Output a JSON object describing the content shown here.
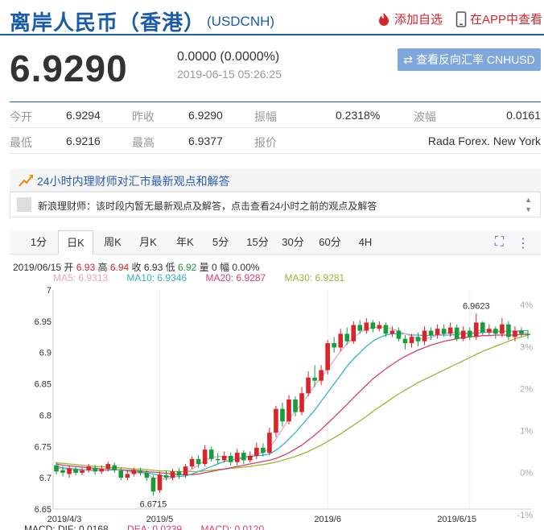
{
  "header": {
    "title": "离岸人民币（香港）",
    "symbol": "(USDCNH)",
    "watchlist_label": "添加自选",
    "app_label": "在APP中查看"
  },
  "quote": {
    "price": "6.9290",
    "change": "0.0000 (0.0000%)",
    "timestamp": "2019-06-15 05:26:25",
    "reverse_label": "查看反向汇率 CNHUSD"
  },
  "stats": [
    [
      {
        "label": "今开",
        "value": "6.9294"
      },
      {
        "label": "昨收",
        "value": "6.9290"
      },
      {
        "label": "振幅",
        "value": "0.2318%"
      },
      {
        "label": "波幅",
        "value": "0.0161"
      }
    ],
    [
      {
        "label": "最低",
        "value": "6.9216"
      },
      {
        "label": "最高",
        "value": "6.9377"
      },
      {
        "label": "报价",
        "value": "Rada Forex. New York"
      }
    ]
  ],
  "opinion": {
    "title": "24小时内理财师对汇市最新观点和解答",
    "text": "新浪理财师：该时段内暂无最新观点及解答，点击查看24小时之前的观点及解答"
  },
  "tabs": [
    "1分",
    "日K",
    "周K",
    "月K",
    "年K",
    "5分",
    "15分",
    "30分",
    "60分",
    "4H"
  ],
  "active_tab": "日K",
  "ohlc": {
    "date": "2019/06/15",
    "open_label": "开",
    "open": "6.93",
    "high_label": "高",
    "high": "6.94",
    "close_label": "收",
    "close": "6.93",
    "low_label": "低",
    "low": "6.92",
    "vol_label": "量",
    "vol": "0",
    "amp_label": "幅",
    "amp": "0.00%"
  },
  "ma": [
    {
      "label": "MA5: 6.9313",
      "color": "#e9a6c9"
    },
    {
      "label": "MA10: 6.9346",
      "color": "#36b3c9"
    },
    {
      "label": "MA20: 6.9287",
      "color": "#d6406e"
    },
    {
      "label": "MA30: 6.9281",
      "color": "#9ab838"
    }
  ],
  "macd": {
    "dif": "MACD: DIF: 0.0168",
    "dea": "DEA: 0.0239",
    "macd": "MACD: 0.0120"
  },
  "chart_data": {
    "type": "candlestick",
    "ylim": [
      6.65,
      7.0
    ],
    "y_ticks": [
      "7",
      "6.95",
      "6.9",
      "6.85",
      "6.8",
      "6.75",
      "6.7",
      "6.65"
    ],
    "pct_ticks": [
      "4%",
      "3%",
      "2%",
      "1%",
      "0%",
      "-1%"
    ],
    "x_labels": [
      "2019/4/3",
      "2019/5",
      "2019/6",
      "2019/6/15"
    ],
    "annotations": [
      {
        "label": "6.9623",
        "value": 6.9623
      },
      {
        "label": "6.6715",
        "value": 6.6715
      }
    ],
    "up_color": "#d6262b",
    "down_color": "#1a9c3a",
    "candles": [
      [
        6.72,
        6.71,
        6.725,
        6.705
      ],
      [
        6.712,
        6.708,
        6.718,
        6.702
      ],
      [
        6.706,
        6.715,
        6.72,
        6.7
      ],
      [
        6.714,
        6.708,
        6.718,
        6.704
      ],
      [
        6.708,
        6.712,
        6.716,
        6.704
      ],
      [
        6.712,
        6.718,
        6.722,
        6.708
      ],
      [
        6.716,
        6.71,
        6.72,
        6.705
      ],
      [
        6.71,
        6.714,
        6.72,
        6.706
      ],
      [
        6.714,
        6.722,
        6.726,
        6.71
      ],
      [
        6.72,
        6.712,
        6.724,
        6.708
      ],
      [
        6.712,
        6.7,
        6.716,
        6.696
      ],
      [
        6.7,
        6.706,
        6.712,
        6.696
      ],
      [
        6.706,
        6.712,
        6.716,
        6.702
      ],
      [
        6.712,
        6.708,
        6.716,
        6.704
      ],
      [
        6.708,
        6.7,
        6.712,
        6.695
      ],
      [
        6.7,
        6.678,
        6.704,
        6.6715
      ],
      [
        6.68,
        6.705,
        6.71,
        6.676
      ],
      [
        6.704,
        6.7,
        6.712,
        6.696
      ],
      [
        6.7,
        6.71,
        6.714,
        6.696
      ],
      [
        6.71,
        6.704,
        6.716,
        6.698
      ],
      [
        6.704,
        6.718,
        6.722,
        6.7
      ],
      [
        6.718,
        6.73,
        6.734,
        6.714
      ],
      [
        6.73,
        6.722,
        6.736,
        6.716
      ],
      [
        6.722,
        6.745,
        6.752,
        6.718
      ],
      [
        6.745,
        6.73,
        6.75,
        6.726
      ],
      [
        6.73,
        6.728,
        6.74,
        6.722
      ],
      [
        6.728,
        6.735,
        6.742,
        6.724
      ],
      [
        6.735,
        6.725,
        6.74,
        6.72
      ],
      [
        6.725,
        6.74,
        6.746,
        6.72
      ],
      [
        6.74,
        6.728,
        6.744,
        6.722
      ],
      [
        6.728,
        6.735,
        6.742,
        6.724
      ],
      [
        6.735,
        6.748,
        6.756,
        6.73
      ],
      [
        6.748,
        6.74,
        6.755,
        6.734
      ],
      [
        6.74,
        6.772,
        6.78,
        6.736
      ],
      [
        6.772,
        6.81,
        6.815,
        6.765
      ],
      [
        6.81,
        6.79,
        6.82,
        6.782
      ],
      [
        6.79,
        6.825,
        6.832,
        6.785
      ],
      [
        6.825,
        6.805,
        6.83,
        6.798
      ],
      [
        6.805,
        6.835,
        6.845,
        6.8
      ],
      [
        6.835,
        6.86,
        6.87,
        6.83
      ],
      [
        6.86,
        6.855,
        6.88,
        6.845
      ],
      [
        6.855,
        6.872,
        6.88,
        6.848
      ],
      [
        6.872,
        6.915,
        6.92,
        6.865
      ],
      [
        6.915,
        6.908,
        6.925,
        6.9
      ],
      [
        6.908,
        6.93,
        6.938,
        6.902
      ],
      [
        6.93,
        6.918,
        6.94,
        6.912
      ],
      [
        6.918,
        6.944,
        6.95,
        6.914
      ],
      [
        6.944,
        6.935,
        6.952,
        6.93
      ],
      [
        6.935,
        6.948,
        6.955,
        6.93
      ],
      [
        6.948,
        6.938,
        6.952,
        6.932
      ],
      [
        6.938,
        6.944,
        6.95,
        6.934
      ],
      [
        6.944,
        6.93,
        6.948,
        6.925
      ],
      [
        6.93,
        6.935,
        6.942,
        6.925
      ],
      [
        6.935,
        6.922,
        6.94,
        6.918
      ],
      [
        6.922,
        6.915,
        6.928,
        6.905
      ],
      [
        6.915,
        6.925,
        6.93,
        6.908
      ],
      [
        6.925,
        6.918,
        6.932,
        6.91
      ],
      [
        6.918,
        6.935,
        6.942,
        6.912
      ],
      [
        6.935,
        6.928,
        6.94,
        6.92
      ],
      [
        6.928,
        6.938,
        6.945,
        6.922
      ],
      [
        6.938,
        6.93,
        6.945,
        6.925
      ],
      [
        6.93,
        6.94,
        6.948,
        6.925
      ],
      [
        6.94,
        6.922,
        6.945,
        6.918
      ],
      [
        6.922,
        6.935,
        6.942,
        6.918
      ],
      [
        6.935,
        6.925,
        6.94,
        6.92
      ],
      [
        6.925,
        6.948,
        6.9623,
        6.92
      ],
      [
        6.948,
        6.932,
        6.95,
        6.928
      ],
      [
        6.932,
        6.938,
        6.945,
        6.928
      ],
      [
        6.938,
        6.93,
        6.942,
        6.922
      ],
      [
        6.93,
        6.945,
        6.955,
        6.925
      ],
      [
        6.945,
        6.925,
        6.95,
        6.92
      ],
      [
        6.925,
        6.935,
        6.942,
        6.918
      ],
      [
        6.935,
        6.93,
        6.94,
        6.925
      ],
      [
        6.93,
        6.928,
        6.936,
        6.922
      ]
    ],
    "ma5": [
      6.716,
      6.714,
      6.713,
      6.712,
      6.711,
      6.713,
      6.713,
      6.712,
      6.714,
      6.715,
      6.712,
      6.71,
      6.708,
      6.707,
      6.706,
      6.7,
      6.698,
      6.698,
      6.7,
      6.704,
      6.708,
      6.714,
      6.72,
      6.728,
      6.732,
      6.734,
      6.734,
      6.732,
      6.732,
      6.733,
      6.735,
      6.738,
      6.74,
      6.748,
      6.762,
      6.778,
      6.794,
      6.806,
      6.818,
      6.832,
      6.848,
      6.86,
      6.874,
      6.888,
      6.902,
      6.914,
      6.924,
      6.932,
      6.938,
      6.94,
      6.941,
      6.94,
      6.938,
      6.934,
      6.93,
      6.926,
      6.922,
      6.922,
      6.924,
      6.928,
      6.93,
      6.932,
      6.932,
      6.932,
      6.93,
      6.934,
      6.936,
      6.936,
      6.934,
      6.935,
      6.934,
      6.933,
      6.932,
      6.931
    ],
    "ma10": [
      6.718,
      6.716,
      6.715,
      6.714,
      6.713,
      6.712,
      6.712,
      6.712,
      6.712,
      6.713,
      6.712,
      6.711,
      6.71,
      6.709,
      6.708,
      6.706,
      6.704,
      6.702,
      6.702,
      6.702,
      6.703,
      6.706,
      6.71,
      6.714,
      6.718,
      6.722,
      6.726,
      6.728,
      6.73,
      6.732,
      6.734,
      6.735,
      6.736,
      6.738,
      6.744,
      6.752,
      6.762,
      6.772,
      6.784,
      6.796,
      6.808,
      6.822,
      6.836,
      6.85,
      6.864,
      6.878,
      6.89,
      6.9,
      6.91,
      6.918,
      6.924,
      6.928,
      6.93,
      6.93,
      6.93,
      6.928,
      6.928,
      6.927,
      6.927,
      6.928,
      6.928,
      6.928,
      6.929,
      6.93,
      6.93,
      6.931,
      6.932,
      6.933,
      6.933,
      6.934,
      6.934,
      6.934,
      6.935,
      6.935
    ],
    "ma20": [
      6.722,
      6.72,
      6.719,
      6.718,
      6.717,
      6.716,
      6.715,
      6.714,
      6.714,
      6.714,
      6.713,
      6.712,
      6.712,
      6.711,
      6.71,
      6.709,
      6.708,
      6.707,
      6.706,
      6.705,
      6.705,
      6.705,
      6.706,
      6.708,
      6.71,
      6.712,
      6.714,
      6.716,
      6.718,
      6.72,
      6.722,
      6.724,
      6.726,
      6.728,
      6.731,
      6.735,
      6.74,
      6.746,
      6.752,
      6.76,
      6.768,
      6.777,
      6.787,
      6.797,
      6.807,
      6.817,
      6.828,
      6.838,
      6.848,
      6.858,
      6.866,
      6.874,
      6.881,
      6.888,
      6.894,
      6.899,
      6.904,
      6.908,
      6.912,
      6.915,
      6.918,
      6.92,
      6.922,
      6.924,
      6.925,
      6.926,
      6.927,
      6.927,
      6.928,
      6.928,
      6.928,
      6.928,
      6.929,
      6.929
    ],
    "ma30": [
      6.724,
      6.723,
      6.722,
      6.721,
      6.72,
      6.719,
      6.718,
      6.718,
      6.717,
      6.716,
      6.716,
      6.715,
      6.714,
      6.714,
      6.713,
      6.712,
      6.711,
      6.711,
      6.71,
      6.71,
      6.71,
      6.71,
      6.71,
      6.711,
      6.712,
      6.713,
      6.714,
      6.715,
      6.716,
      6.717,
      6.718,
      6.72,
      6.721,
      6.723,
      6.725,
      6.728,
      6.731,
      6.734,
      6.738,
      6.742,
      6.747,
      6.752,
      6.758,
      6.764,
      6.77,
      6.777,
      6.784,
      6.791,
      6.798,
      6.806,
      6.813,
      6.82,
      6.827,
      6.834,
      6.84,
      6.846,
      6.852,
      6.857,
      6.862,
      6.867,
      6.872,
      6.877,
      6.882,
      6.887,
      6.892,
      6.897,
      6.902,
      6.906,
      6.91,
      6.914,
      6.918,
      6.922,
      6.925,
      6.928
    ]
  }
}
